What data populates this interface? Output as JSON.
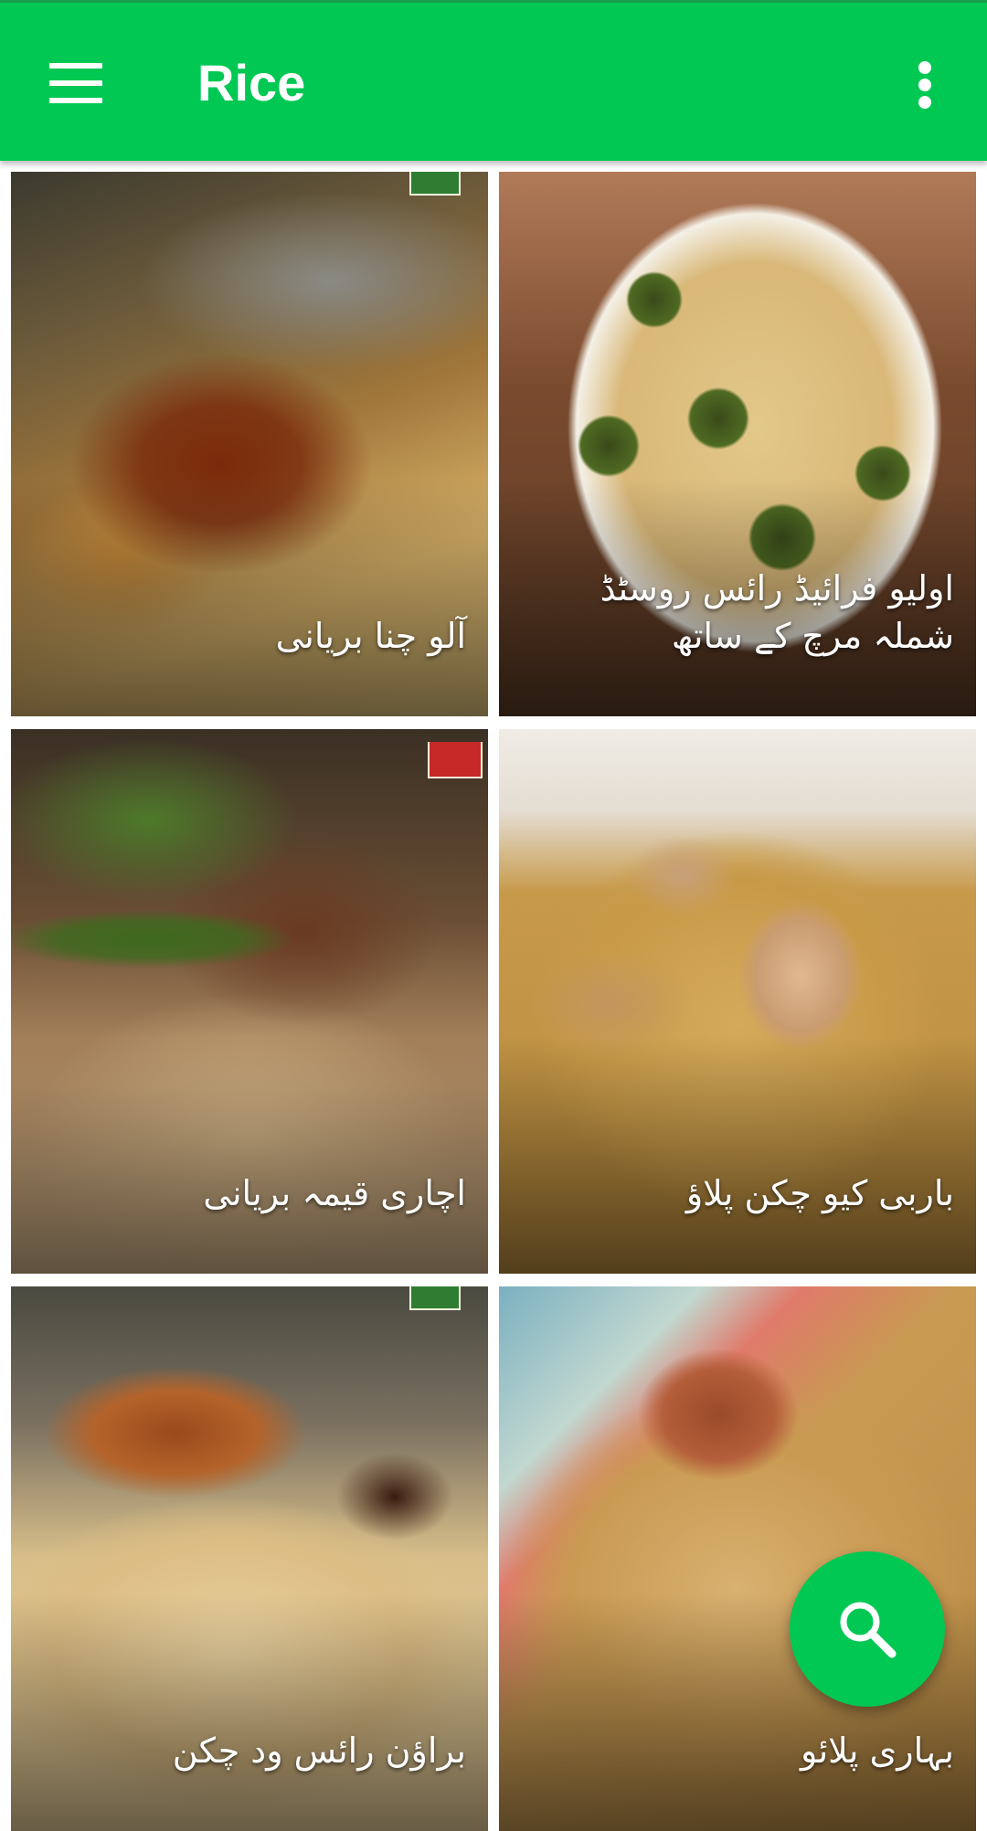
{
  "app_bar": {
    "title": "Rice",
    "color": "#00C853",
    "menu_icon": "hamburger-menu-icon",
    "overflow_icon": "more-vert-icon"
  },
  "recipes": [
    {
      "title": "آلو چنا بریانی"
    },
    {
      "title": "اولیو فرائیڈ رائس روسٹڈ شملہ مرچ کے ساتھ"
    },
    {
      "title": "اچاری قیمہ بریانی"
    },
    {
      "title": "باربی کیو چکن پلاؤ"
    },
    {
      "title": "براؤن رائس ود چکن"
    },
    {
      "title": "بہاری پلائو"
    }
  ],
  "fab": {
    "icon": "search-icon",
    "color": "#00C853"
  }
}
